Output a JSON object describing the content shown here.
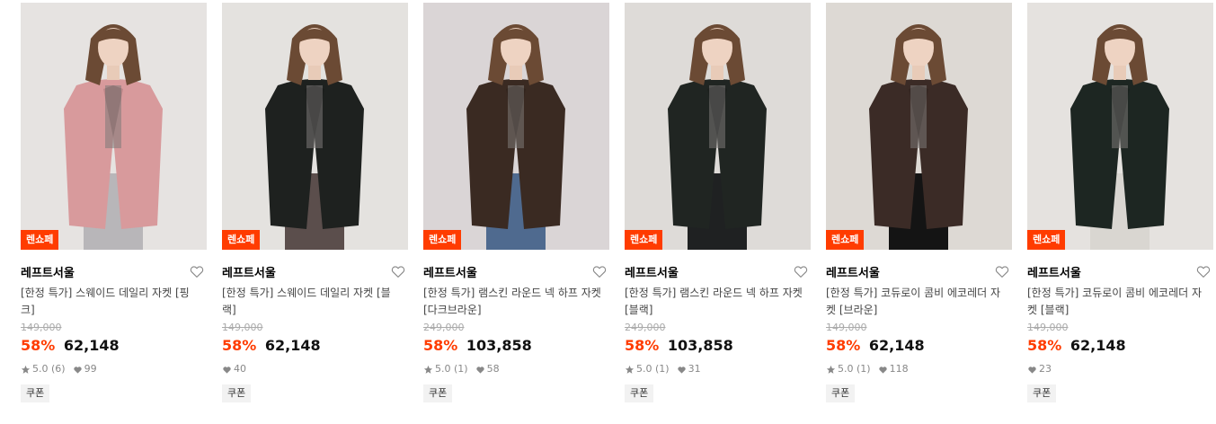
{
  "products": [
    {
      "badge": "렌쇼페",
      "brand": "레프트서울",
      "title": "[한정 특가] 스웨이드 데일리 자켓 [핑크]",
      "original_price": "149,000",
      "discount": "58%",
      "price": "62,148",
      "rating": "5.0 (6)",
      "likes": "99",
      "coupon": "쿠폰",
      "jacket_color": "#d89a9c",
      "bg_color": "#e6e3e1",
      "bottom_color": "#b8b6b9"
    },
    {
      "badge": "렌쇼페",
      "brand": "레프트서울",
      "title": "[한정 특가] 스웨이드 데일리 자켓 [블랙]",
      "original_price": "149,000",
      "discount": "58%",
      "price": "62,148",
      "rating": "",
      "likes": "40",
      "coupon": "쿠폰",
      "jacket_color": "#1e211f",
      "bg_color": "#e4e2df",
      "bottom_color": "#5b4e4c"
    },
    {
      "badge": "렌쇼페",
      "brand": "레프트서울",
      "title": "[한정 특가] 램스킨 라운드 넥 하프 자켓 [다크브라운]",
      "original_price": "249,000",
      "discount": "58%",
      "price": "103,858",
      "rating": "5.0 (1)",
      "likes": "58",
      "coupon": "쿠폰",
      "jacket_color": "#3a2a22",
      "bg_color": "#dad5d6",
      "bottom_color": "#4f6a8f"
    },
    {
      "badge": "렌쇼페",
      "brand": "레프트서울",
      "title": "[한정 특가] 램스킨 라운드 넥 하프 자켓 [블랙]",
      "original_price": "249,000",
      "discount": "58%",
      "price": "103,858",
      "rating": "5.0 (1)",
      "likes": "31",
      "coupon": "쿠폰",
      "jacket_color": "#202522",
      "bg_color": "#dedbd8",
      "bottom_color": "#1f2122"
    },
    {
      "badge": "렌쇼페",
      "brand": "레프트서울",
      "title": "[한정 특가] 코듀로이 콤비 에코레더 자켓 [브라운]",
      "original_price": "149,000",
      "discount": "58%",
      "price": "62,148",
      "rating": "5.0 (1)",
      "likes": "118",
      "coupon": "쿠폰",
      "jacket_color": "#3b2b26",
      "bg_color": "#ddd9d4",
      "bottom_color": "#141414"
    },
    {
      "badge": "렌쇼페",
      "brand": "레프트서울",
      "title": "[한정 특가] 코듀로이 콤비 에코레더 자켓 [블랙]",
      "original_price": "149,000",
      "discount": "58%",
      "price": "62,148",
      "rating": "",
      "likes": "23",
      "coupon": "쿠폰",
      "jacket_color": "#1d2622",
      "bg_color": "#e5e2df",
      "bottom_color": "#d9d6d1"
    }
  ],
  "colors": {
    "accent": "#ff3c00",
    "muted": "#888888"
  },
  "icons": {
    "wishlist": "heart-outline-icon",
    "rating": "star-icon",
    "likes": "heart-filled-icon"
  }
}
